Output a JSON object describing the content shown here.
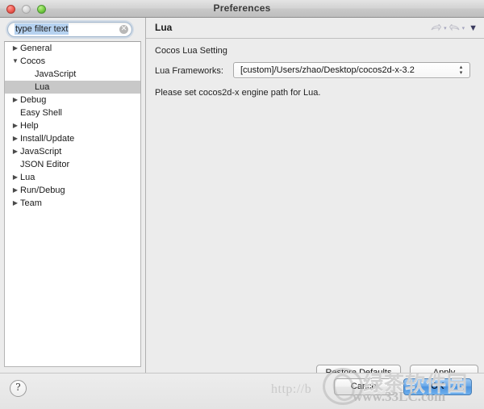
{
  "window": {
    "title": "Preferences",
    "controls": {
      "close": "close-button",
      "minimize": "minimize-button",
      "zoom": "zoom-button"
    }
  },
  "sidebar": {
    "filter": {
      "value": "type filter text",
      "placeholder": "type filter text",
      "clear_icon": "✕"
    },
    "tree": [
      {
        "label": "General",
        "level": 1,
        "twisty": "▶",
        "selected": false
      },
      {
        "label": "Cocos",
        "level": 1,
        "twisty": "▼",
        "selected": false
      },
      {
        "label": "JavaScript",
        "level": 2,
        "twisty": "",
        "selected": false
      },
      {
        "label": "Lua",
        "level": 2,
        "twisty": "",
        "selected": true
      },
      {
        "label": "Debug",
        "level": 1,
        "twisty": "▶",
        "selected": false
      },
      {
        "label": "Easy Shell",
        "level": 1,
        "twisty": "",
        "selected": false
      },
      {
        "label": "Help",
        "level": 1,
        "twisty": "▶",
        "selected": false
      },
      {
        "label": "Install/Update",
        "level": 1,
        "twisty": "▶",
        "selected": false
      },
      {
        "label": "JavaScript",
        "level": 1,
        "twisty": "▶",
        "selected": false
      },
      {
        "label": "JSON Editor",
        "level": 1,
        "twisty": "",
        "selected": false
      },
      {
        "label": "Lua",
        "level": 1,
        "twisty": "▶",
        "selected": false
      },
      {
        "label": "Run/Debug",
        "level": 1,
        "twisty": "▶",
        "selected": false
      },
      {
        "label": "Team",
        "level": 1,
        "twisty": "▶",
        "selected": false
      }
    ]
  },
  "panel": {
    "title": "Lua",
    "tools": {
      "back_caret": "▾",
      "forward_caret": "▾",
      "menu_caret": "▼"
    },
    "group_label": "Cocos Lua Setting",
    "field_label": "Lua Frameworks:",
    "field_value": "[custom]/Users/zhao/Desktop/cocos2d-x-3.2",
    "stepper_glyph_up": "▴",
    "stepper_glyph_down": "▾",
    "hint": "Please set cocos2d-x engine path for Lua.",
    "restore_defaults_label": "Restore Defaults",
    "apply_label": "Apply"
  },
  "footer": {
    "help_label": "?",
    "cancel_label": "Cancel",
    "ok_label": "OK"
  },
  "watermark": {
    "url_left": "http://b",
    "site": "www.33LC.com",
    "brand_cn": "绿茶软件园"
  },
  "colors": {
    "selection_blue": "#b6d2f0",
    "tree_selected_gray": "#c8c8c8",
    "default_button_blue": "#4b93e0",
    "window_chrome": "#ececec"
  }
}
